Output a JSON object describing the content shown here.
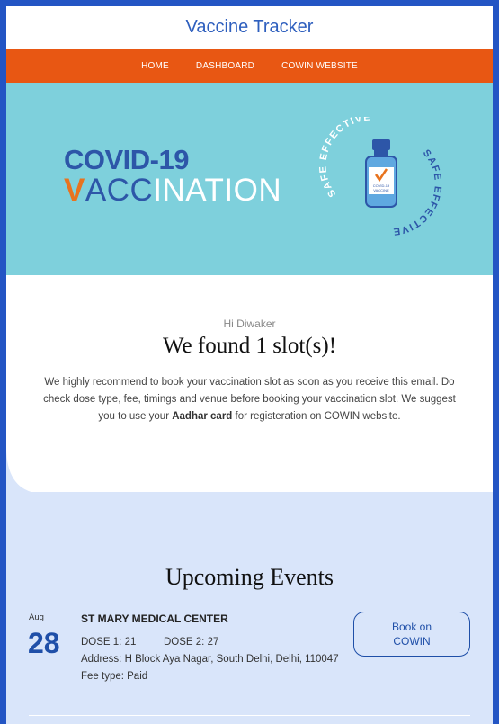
{
  "header": {
    "title": "Vaccine Tracker"
  },
  "nav": {
    "items": [
      {
        "label": "HOME"
      },
      {
        "label": "DASHBOARD"
      },
      {
        "label": "COWIN WEBSITE"
      }
    ]
  },
  "hero": {
    "line1": "COVID-19",
    "line2_v": "V",
    "line2_cc": "ACC",
    "line2_rest": "INATION",
    "badge_top": "SAFE EFFECTIVE",
    "badge_bottom": "SAFE EFFECTIVE",
    "vial_label_1": "COVID-19",
    "vial_label_2": "VACCINE"
  },
  "message": {
    "greeting": "Hi Diwaker",
    "headline": "We found 1 slot(s)!",
    "text_before": "We highly recommend to book your vaccination slot as soon as you receive this email. Do check dose type, fee, timings and venue before booking your vaccination slot. We suggest you to use your ",
    "text_bold": "Aadhar card",
    "text_after": " for registeration on COWIN website."
  },
  "events": {
    "title": "Upcoming Events",
    "items": [
      {
        "month": "Aug",
        "day": "28",
        "center": "ST MARY MEDICAL CENTER",
        "dose1": "DOSE 1: 21",
        "dose2": "DOSE 2: 27",
        "address": "Address: H Block Aya Nagar, South Delhi, Delhi, 110047",
        "fee": "Fee type: Paid",
        "button": "Book on COWIN"
      }
    ]
  },
  "colors": {
    "frame": "#2355c4",
    "nav": "#e85713",
    "hero": "#7ed0dc",
    "lower": "#d9e5fa",
    "accent": "#1f4fa8"
  }
}
